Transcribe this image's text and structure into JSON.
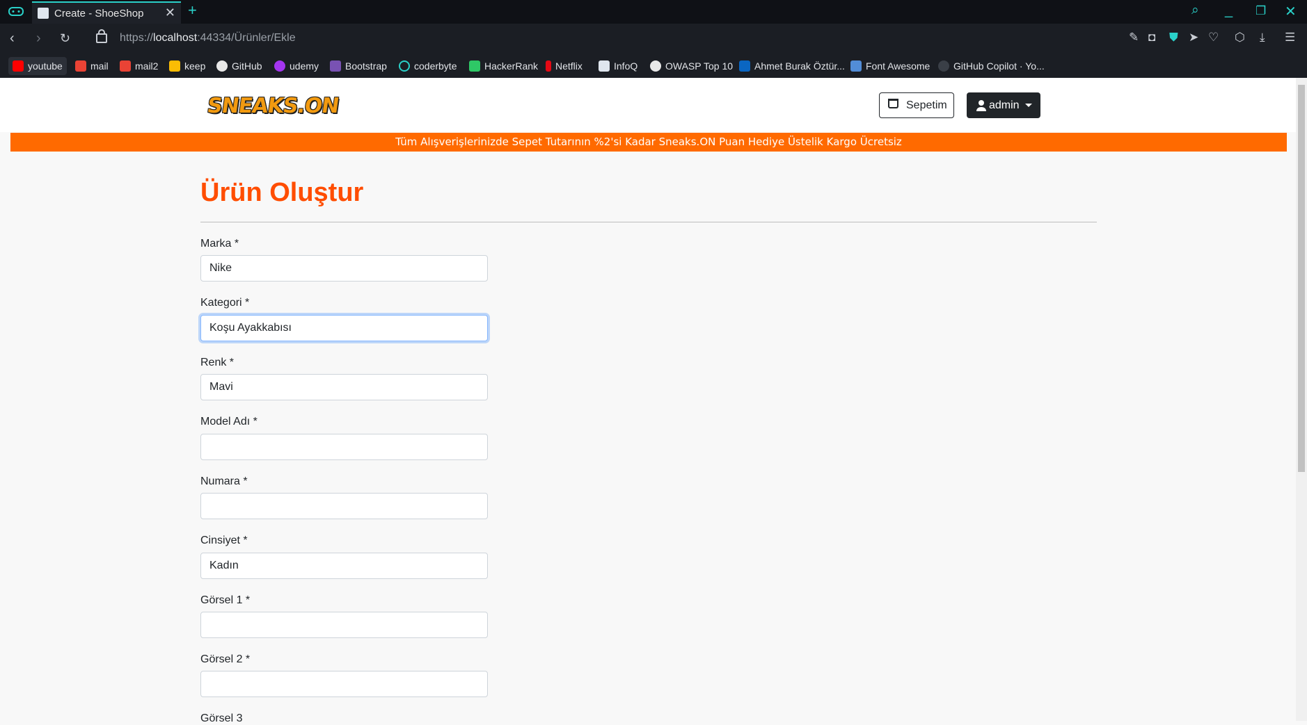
{
  "browser": {
    "tab_title": "Create - ShoeShop",
    "new_tab": "+",
    "url_prefix": "https://",
    "url_host": "localhost",
    "url_rest": ":44334/Ürünler/Ekle",
    "bookmarks": [
      "youtube",
      "mail",
      "mail2",
      "keep",
      "GitHub",
      "udemy",
      "Bootstrap",
      "coderbyte",
      "HackerRank",
      "Netflix",
      "InfoQ",
      "OWASP Top 10",
      "Ahmet Burak Öztür...",
      "Font Awesome",
      "GitHub Copilot · Yo..."
    ]
  },
  "header": {
    "logo_text": "SNEAKS.ON",
    "cart_label": "Sepetim",
    "user_label": "admin"
  },
  "promo_text": "Tüm Alışverişlerinizde Sepet Tutarının %2'si Kadar Sneaks.ON Puan Hediye Üstelik Kargo Ücretsiz",
  "page_title": "Ürün Oluştur",
  "form": {
    "fields": [
      {
        "label": "Marka *",
        "value": "Nike"
      },
      {
        "label": "Kategori *",
        "value": "Koşu Ayakkabısı"
      },
      {
        "label": "Renk *",
        "value": "Mavi"
      },
      {
        "label": "Model Adı *",
        "value": ""
      },
      {
        "label": "Numara *",
        "value": ""
      },
      {
        "label": "Cinsiyet *",
        "value": "Kadın"
      },
      {
        "label": "Görsel 1 *",
        "value": ""
      },
      {
        "label": "Görsel 2 *",
        "value": ""
      },
      {
        "label": "Görsel 3",
        "value": ""
      }
    ]
  },
  "colors": {
    "accent": "#ff4d00",
    "promo_bg": "#ff6a00",
    "tab_accent": "#2ad1c9"
  }
}
